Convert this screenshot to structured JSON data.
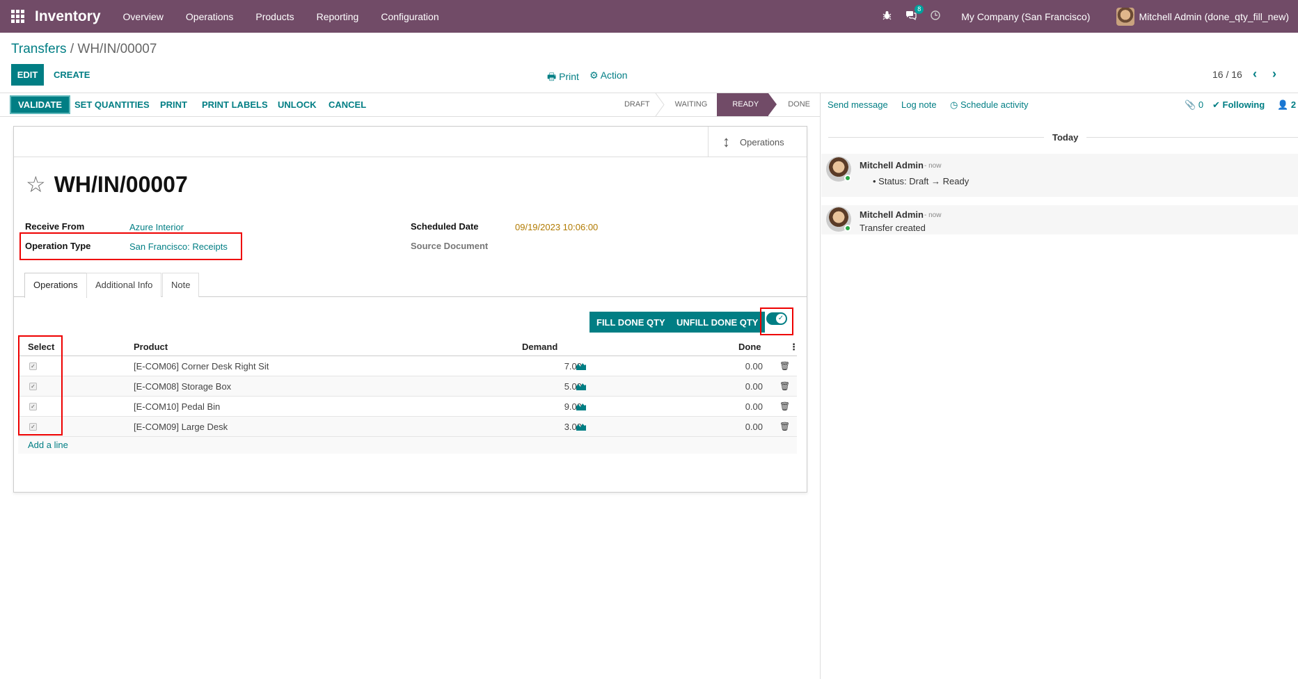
{
  "navbar": {
    "brand": "Inventory",
    "menu": [
      "Overview",
      "Operations",
      "Products",
      "Reporting",
      "Configuration"
    ],
    "messages_badge": "8",
    "company": "My Company (San Francisco)",
    "user": "Mitchell Admin (done_qty_fill_new)"
  },
  "control": {
    "breadcrumb_parent": "Transfers",
    "breadcrumb_sep": "/",
    "breadcrumb_current": "WH/IN/00007",
    "edit": "EDIT",
    "create": "CREATE",
    "print": "Print",
    "action": "Action",
    "pager": "16 / 16"
  },
  "statusbar": {
    "buttons": [
      "VALIDATE",
      "SET QUANTITIES",
      "PRINT",
      "PRINT LABELS",
      "UNLOCK",
      "CANCEL"
    ],
    "stages": [
      "DRAFT",
      "WAITING",
      "READY",
      "DONE"
    ],
    "active_stage": "READY"
  },
  "form": {
    "smart_button": "Operations",
    "title": "WH/IN/00007",
    "receive_from_label": "Receive From",
    "receive_from": "Azure Interior",
    "operation_type_label": "Operation Type",
    "operation_type": "San Francisco: Receipts",
    "scheduled_date_label": "Scheduled Date",
    "scheduled_date": "09/19/2023 10:06:00",
    "source_document_label": "Source Document",
    "tabs": [
      "Operations",
      "Additional Info",
      "Note"
    ],
    "fill_done": "FILL DONE QTY",
    "unfill_done": "UNFILL DONE QTY",
    "toggle_on": true
  },
  "table": {
    "headers": [
      "Select",
      "Product",
      "Demand",
      "Done"
    ],
    "rows": [
      {
        "product": "[E-COM06] Corner Desk Right Sit",
        "demand": "7.00",
        "done": "0.00",
        "checked": true
      },
      {
        "product": "[E-COM08] Storage Box",
        "demand": "5.00",
        "done": "0.00",
        "checked": true
      },
      {
        "product": "[E-COM10] Pedal Bin",
        "demand": "9.00",
        "done": "0.00",
        "checked": true
      },
      {
        "product": "[E-COM09] Large Desk",
        "demand": "3.00",
        "done": "0.00",
        "checked": true
      }
    ],
    "add_line": "Add a line"
  },
  "chatter": {
    "send_message": "Send message",
    "log_note": "Log note",
    "schedule_activity": "Schedule activity",
    "attachments": "0",
    "following": "Following",
    "followers": "2",
    "today": "Today",
    "messages": [
      {
        "author": "Mitchell Admin",
        "time": "- now",
        "body": "Status: Draft → Ready"
      },
      {
        "author": "Mitchell Admin",
        "time": "- now",
        "body": "Transfer created"
      }
    ]
  },
  "colors": {
    "brand": "#714B67",
    "accent": "#017e84",
    "highlight": "#e00000"
  }
}
